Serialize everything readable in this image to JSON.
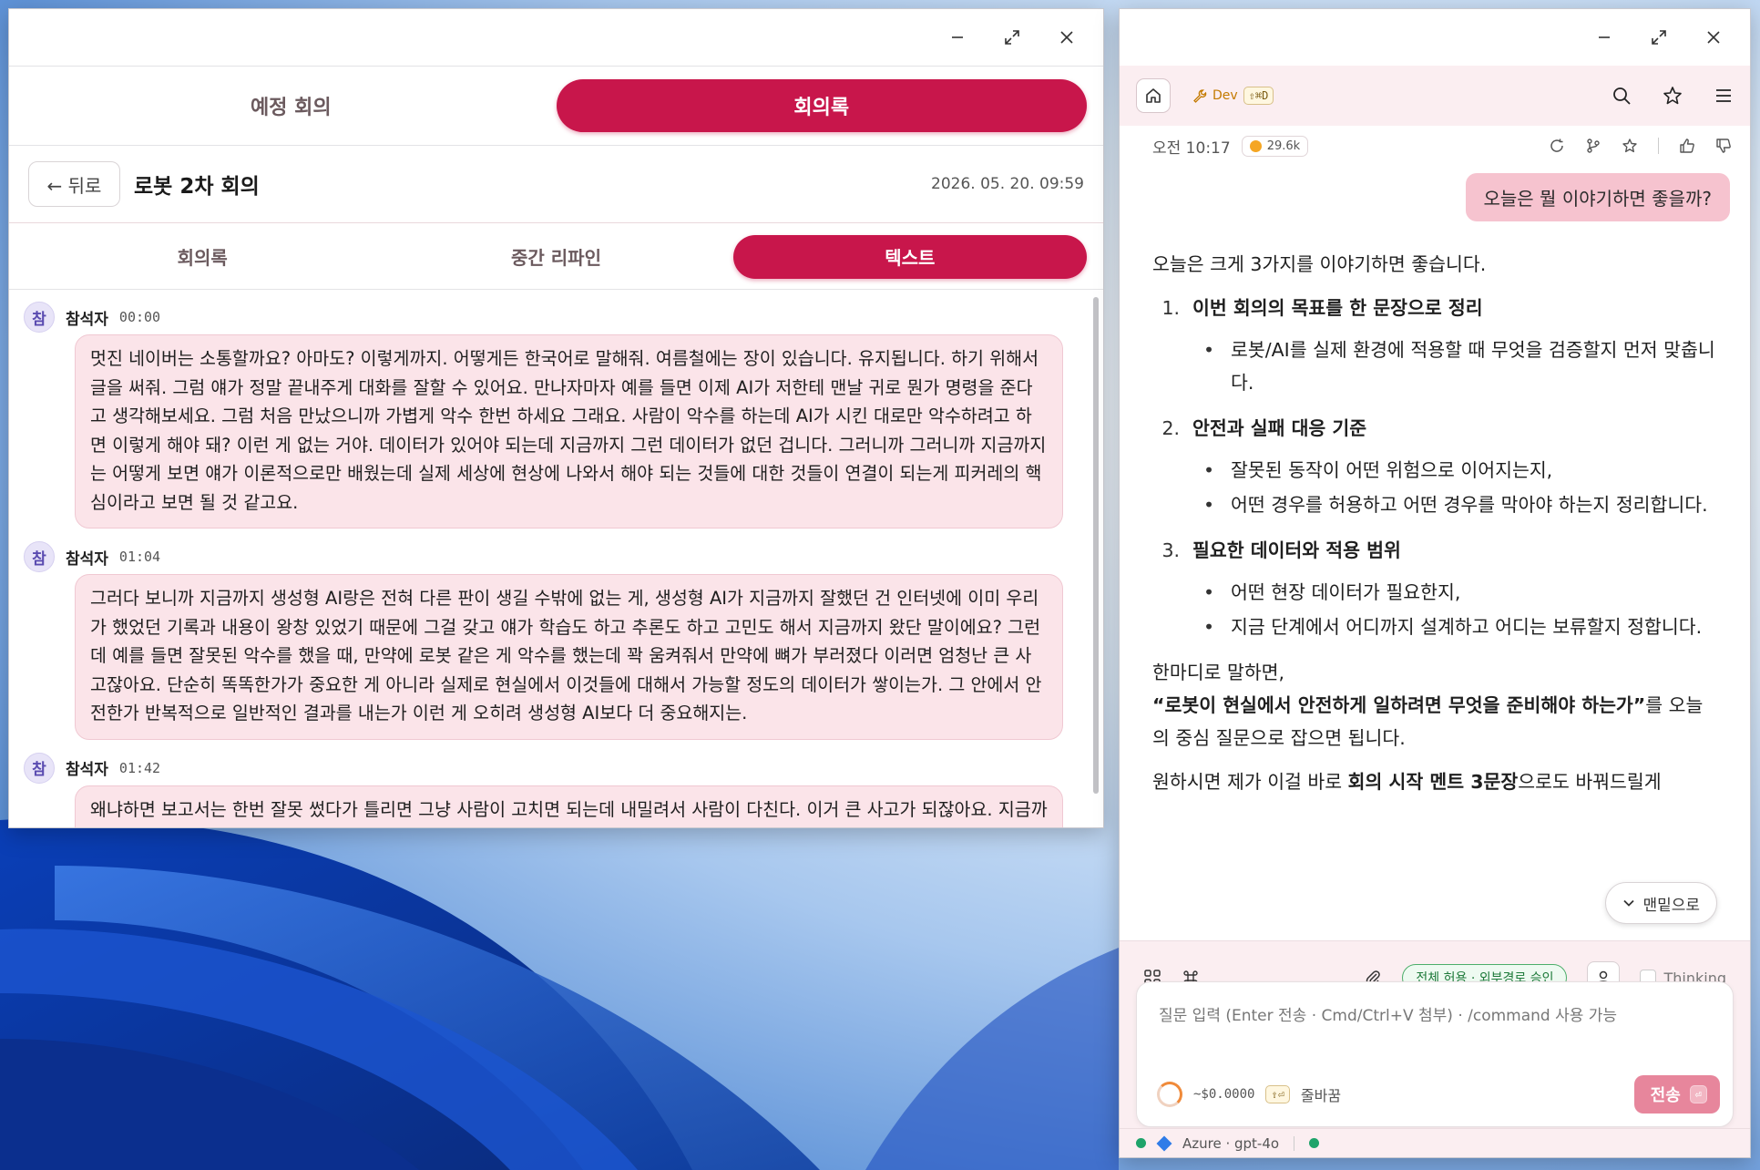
{
  "colors": {
    "accent": "#c8164b",
    "bubble": "#fbe4e9",
    "user_bubble": "#f6c3cf"
  },
  "left_window": {
    "tabs": [
      {
        "label": "예정 회의",
        "active": false
      },
      {
        "label": "회의록",
        "active": true
      }
    ],
    "back_label": "← 뒤로",
    "meeting_title": "로봇 2차 회의",
    "meeting_date": "2026. 05. 20. 09:59",
    "sub_tabs": [
      {
        "label": "회의록",
        "active": false
      },
      {
        "label": "중간 리파인",
        "active": false
      },
      {
        "label": "텍스트",
        "active": true
      }
    ],
    "transcript": [
      {
        "avatar": "참",
        "speaker": "참석자",
        "time": "00:00",
        "text": "멋진 네이버는 소통할까요? 아마도? 이렇게까지. 어떻게든 한국어로 말해줘. 여름철에는 장이 있습니다. 유지됩니다. 하기 위해서 글을 써줘. 그럼 얘가 정말 끝내주게 대화를 잘할 수 있어요. 만나자마자 예를 들면 이제 AI가 저한테 맨날 귀로 뭔가 명령을 준다고 생각해보세요. 그럼 처음 만났으니까 가볍게 악수 한번 하세요 그래요. 사람이 악수를 하는데 AI가 시킨 대로만 악수하려고 하면 이렇게 해야 돼? 이런 게 없는 거야. 데이터가 있어야 되는데 지금까지 그런 데이터가 없던 겁니다. 그러니까 그러니까 지금까지는 어떻게 보면 얘가 이론적으로만 배웠는데 실제 세상에 현상에 나와서 해야 되는 것들에 대한 것들이 연결이 되는게 피커레의 핵심이라고 보면 될 것 같고요."
      },
      {
        "avatar": "참",
        "speaker": "참석자",
        "time": "01:04",
        "text": "그러다 보니까 지금까지 생성형 AI랑은 전혀 다른 판이 생길 수밖에 없는 게, 생성형 AI가 지금까지 잘했던 건 인터넷에 이미 우리가 했었던 기록과 내용이 왕창 있었기 때문에 그걸 갖고 얘가 학습도 하고 추론도 하고 고민도 해서 지금까지 왔단 말이에요? 그런데 예를 들면 잘못된 악수를 했을 때, 만약에 로봇 같은 게 악수를 했는데 꽉 움켜줘서 만약에 뼈가 부러졌다 이러면 엄청난 큰 사고잖아요. 단순히 똑똑한가가 중요한 게 아니라 실제로 현실에서 이것들에 대해서 가능할 정도의 데이터가 쌓이는가. 그 안에서 안전한가 반복적으로 일반적인 결과를 내는가 이런 게 오히려 생성형 AI보다 더 중요해지는."
      },
      {
        "avatar": "참",
        "speaker": "참석자",
        "time": "01:42",
        "text": "왜냐하면 보고서는 한번 잘못 썼다가 틀리면 그냥 사람이 고치면 되는데 내밀려서 사람이 다친다. 이거 큰 사고가 되잖아요. 지금까지는"
      }
    ]
  },
  "right_window": {
    "toolbar": {
      "dev_label": "Dev",
      "dev_shortcut": "⇧⌘D"
    },
    "message_time": "오전 10:17",
    "token_count": "29.6k",
    "user_message": "오늘은 뭘 이야기하면 좋을까?",
    "answer": {
      "intro": "오늘은 크게 3가지를 이야기하면 좋습니다.",
      "items": [
        {
          "num": "1.",
          "title": "이번 회의의 목표를 한 문장으로 정리",
          "bullets": [
            "로봇/AI를 실제 환경에 적용할 때 무엇을 검증할지 먼저 맞춥니다."
          ]
        },
        {
          "num": "2.",
          "title": "안전과 실패 대응 기준",
          "bullets": [
            "잘못된 동작이 어떤 위험으로 이어지는지,",
            "어떤 경우를 허용하고 어떤 경우를 막아야 하는지 정리합니다."
          ]
        },
        {
          "num": "3.",
          "title": "필요한 데이터와 적용 범위",
          "bullets": [
            "어떤 현장 데이터가 필요한지,",
            "지금 단계에서 어디까지 설계하고 어디는 보류할지 정합니다."
          ]
        }
      ],
      "summary_lead": "한마디로 말하면,",
      "summary_bold": "“로봇이 현실에서 안전하게 일하려면 무엇을 준비해야 하는가”",
      "summary_tail": "를 오늘의 중심 질문으로 잡으면 됩니다.",
      "cutoff_pre": "원하시면 제가 이걸 바로 ",
      "cutoff_bold": "회의 시작 멘트 3문장",
      "cutoff_post": "으로도 바꿔드릴게"
    },
    "jump_label": "맨밑으로",
    "permission_badge": "전체 허용 · 외부경로 승인",
    "thinking_label": "Thinking",
    "input_placeholder": "질문 입력 (Enter 전송 · Cmd/Ctrl+V 첨부) · /command 사용 가능",
    "cost": "~$0.0000",
    "newline_shortcut": "⇧⏎",
    "newline_label": "줄바꿈",
    "send_label": "전송",
    "send_shortcut": "⏎",
    "status_model": "Azure · gpt-4o"
  }
}
